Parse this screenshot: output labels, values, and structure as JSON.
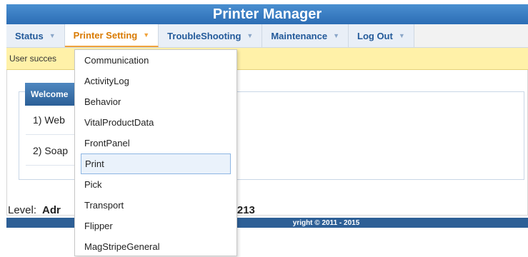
{
  "app": {
    "title": "Printer Manager"
  },
  "nav": {
    "items": [
      {
        "label": "Status",
        "icon": "chevron-down-icon"
      },
      {
        "label": "Printer Setting",
        "icon": "chevron-down-icon"
      },
      {
        "label": "TroubleShooting",
        "icon": "chevron-down-icon"
      },
      {
        "label": "Maintenance",
        "icon": "chevron-down-icon"
      },
      {
        "label": "Log Out",
        "icon": "chevron-down-icon"
      }
    ]
  },
  "notice": {
    "text": "User succes"
  },
  "welcome": {
    "title": "Welcome",
    "lines": [
      "1) Web",
      "2) Soap"
    ]
  },
  "status": {
    "level_label": "Level:",
    "level_value": "Adr",
    "right_text": "213"
  },
  "footer": {
    "text": "yright © 2011 - 2015"
  },
  "dropdown": {
    "items": [
      "Communication",
      "ActivityLog",
      "Behavior",
      "VitalProductData",
      "FrontPanel",
      "Print",
      "Pick",
      "Transport",
      "Flipper",
      "MagStripeGeneral"
    ],
    "highlighted": "Print"
  },
  "colors": {
    "header_gradient_top": "#4a8fd0",
    "header_gradient_bottom": "#2c6db5",
    "nav_active": "#d97a00",
    "notice_bg": "#fff1a8",
    "footer_bg": "#2d5f96"
  }
}
